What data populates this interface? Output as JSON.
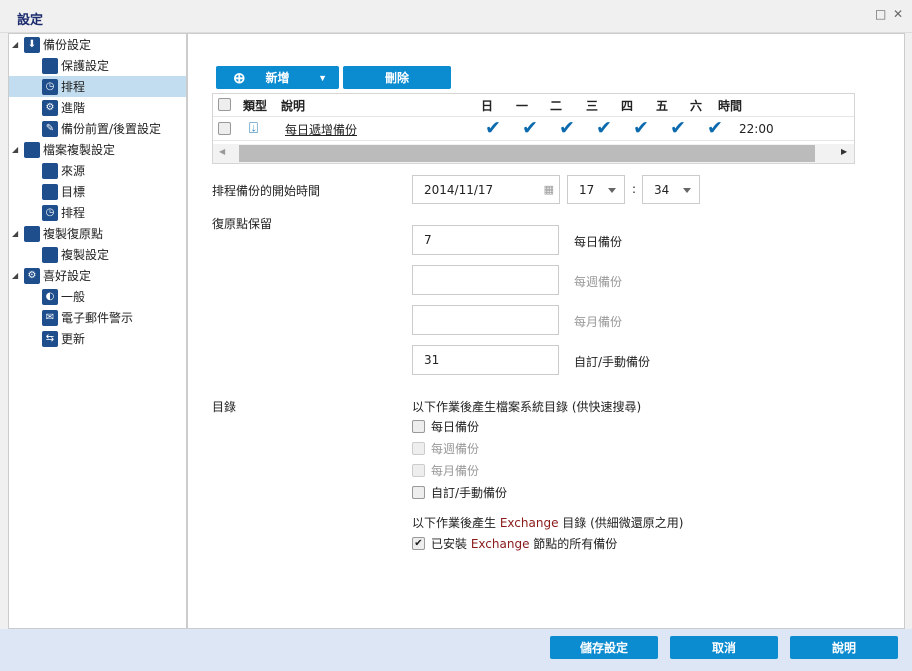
{
  "window": {
    "title": "設定",
    "restore_icon": "□",
    "close_icon": "✕"
  },
  "sidebar": {
    "groups": [
      {
        "label": "備份設定",
        "items": [
          "保護設定",
          "排程",
          "進階",
          "備份前置/後置設定"
        ]
      },
      {
        "label": "檔案複製設定",
        "items": [
          "來源",
          "目標",
          "排程"
        ]
      },
      {
        "label": "複製復原點",
        "items": [
          "複製設定"
        ]
      },
      {
        "label": "喜好設定",
        "items": [
          "一般",
          "電子郵件警示",
          "更新"
        ]
      }
    ],
    "selected": "排程"
  },
  "toolbar": {
    "add": "新增",
    "delete": "刪除"
  },
  "grid": {
    "headers": {
      "type": "類型",
      "desc": "說明",
      "days": [
        "日",
        "一",
        "二",
        "三",
        "四",
        "五",
        "六"
      ],
      "time": "時間"
    },
    "rows": [
      {
        "desc": "每日遞增備份",
        "time": "22:00"
      }
    ]
  },
  "schedule": {
    "start_label": "排程備份的開始時間",
    "date": "2014/11/17",
    "hour": "17",
    "colon": ":",
    "minute": "34"
  },
  "retention": {
    "label": "復原點保留",
    "daily_value": "7",
    "daily": "每日備份",
    "weekly_value": "",
    "weekly": "每週備份",
    "monthly_value": "",
    "monthly": "每月備份",
    "custom_value": "31",
    "custom": "自訂/手動備份"
  },
  "catalog": {
    "label": "目錄",
    "fs_heading": "以下作業後產生檔案系統目錄 (供快速搜尋)",
    "options": [
      "每日備份",
      "每週備份",
      "每月備份",
      "自訂/手動備份"
    ],
    "ex_heading_pre": "以下作業後產生 ",
    "ex_word": "Exchange",
    "ex_heading_post": " 目錄 (供細微還原之用)",
    "ex_opt_pre": "已安裝 ",
    "ex_opt_post": " 節點的所有備份"
  },
  "footer": {
    "save": "儲存設定",
    "cancel": "取消",
    "help": "說明"
  }
}
